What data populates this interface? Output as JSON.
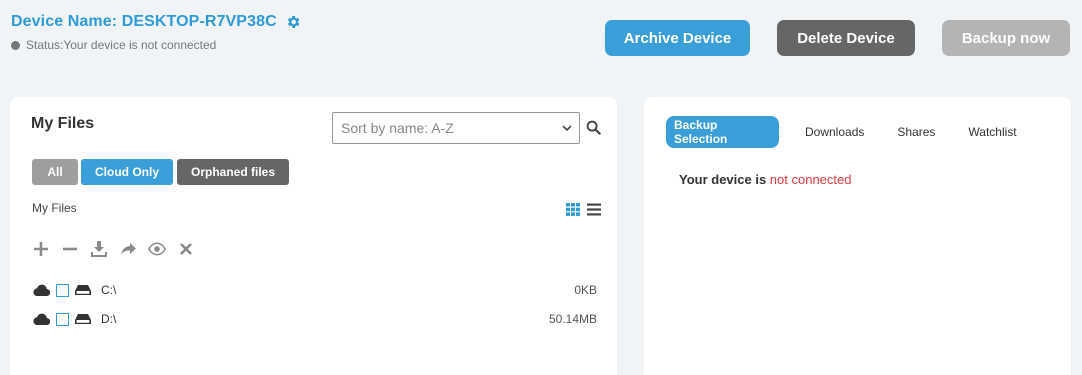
{
  "header": {
    "device_name": "Device Name: DESKTOP-R7VP38C",
    "status": "Status:Your device is not connected"
  },
  "actions": {
    "archive_label": "Archive Device",
    "delete_label": "Delete Device",
    "backup_label": "Backup now"
  },
  "files_panel": {
    "title": "My Files",
    "sort": {
      "selected": "Sort by name: A-Z"
    },
    "filters": [
      "All",
      "Cloud Only",
      "Orphaned files"
    ],
    "breadcrumb": "My Files",
    "files": [
      {
        "name": "C:\\",
        "size": "0KB"
      },
      {
        "name": "D:\\",
        "size": "50.14MB"
      }
    ]
  },
  "right_panel": {
    "tabs": [
      "Backup Selection",
      "Downloads",
      "Shares",
      "Watchlist"
    ],
    "message_prefix": "Your device is ",
    "message_status": "not connected"
  },
  "colors": {
    "accent": "#3a9fd8",
    "dark_button": "#666666",
    "disabled_button": "#b4b4b4",
    "error": "#e03a3a"
  }
}
